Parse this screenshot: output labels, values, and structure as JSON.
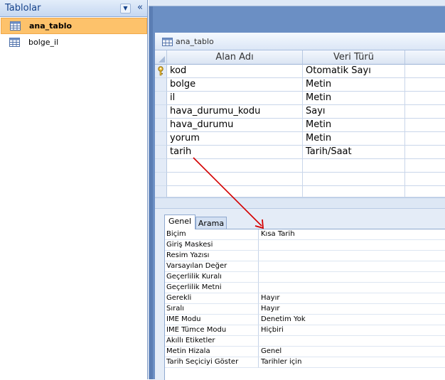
{
  "nav": {
    "title": "Tablolar",
    "items": [
      {
        "label": "ana_tablo",
        "selected": true
      },
      {
        "label": "bolge_il",
        "selected": false
      }
    ]
  },
  "object": {
    "title": "ana_tablo"
  },
  "grid": {
    "headers": {
      "name": "Alan Adı",
      "type": "Veri Türü",
      "description": ""
    },
    "rows": [
      {
        "name": "kod",
        "type": "Otomatik Sayı",
        "primary_key": true
      },
      {
        "name": "bolge",
        "type": "Metin"
      },
      {
        "name": "il",
        "type": "Metin"
      },
      {
        "name": "hava_durumu_kodu",
        "type": "Sayı"
      },
      {
        "name": "hava_durumu",
        "type": "Metin"
      },
      {
        "name": "yorum",
        "type": "Metin"
      },
      {
        "name": "tarih",
        "type": "Tarih/Saat"
      }
    ]
  },
  "properties": {
    "tabs": [
      "Genel",
      "Arama"
    ],
    "active_tab": "Genel",
    "rows": [
      {
        "name": "Biçim",
        "value": "Kısa Tarih"
      },
      {
        "name": "Giriş Maskesi",
        "value": ""
      },
      {
        "name": "Resim Yazısı",
        "value": ""
      },
      {
        "name": "Varsayılan Değer",
        "value": ""
      },
      {
        "name": "Geçerlilik Kuralı",
        "value": ""
      },
      {
        "name": "Geçerlilik Metni",
        "value": ""
      },
      {
        "name": "Gerekli",
        "value": "Hayır"
      },
      {
        "name": "Sıralı",
        "value": "Hayır"
      },
      {
        "name": "IME Modu",
        "value": "Denetim Yok"
      },
      {
        "name": "IME Tümce Modu",
        "value": "Hiçbiri"
      },
      {
        "name": "Akıllı Etiketler",
        "value": ""
      },
      {
        "name": "Metin Hizala",
        "value": "Genel"
      },
      {
        "name": "Tarih Seçiciyi Göster",
        "value": "Tarihler için"
      }
    ]
  },
  "colors": {
    "selected_item": "#fdc26b",
    "workspace": "#6b8fc4",
    "arrow": "#d40000"
  },
  "icons": [
    "table-icon",
    "key-icon",
    "chevron-down-icon",
    "collapse-icon"
  ]
}
